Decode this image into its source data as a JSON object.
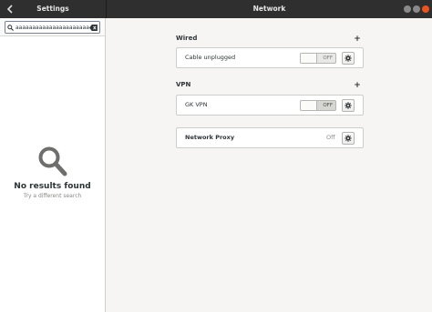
{
  "header": {
    "left_title": "Settings",
    "main_title": "Network",
    "accent_close": "#e9541f"
  },
  "sidebar": {
    "search": {
      "value": "aaaaaaaaaaaaaaaaaaaaaa",
      "placeholder": ""
    },
    "empty_state": {
      "icon": "search-icon",
      "title": "No results found",
      "subtitle": "Try a different search"
    }
  },
  "network": {
    "wired": {
      "title": "Wired",
      "add_label": "+",
      "connection": {
        "label": "Cable unplugged",
        "switch_state": "OFF"
      }
    },
    "vpn": {
      "title": "VPN",
      "add_label": "+",
      "connection": {
        "label": "GK VPN",
        "switch_state": "OFF"
      }
    },
    "proxy": {
      "label": "Network Proxy",
      "state": "Off"
    }
  }
}
